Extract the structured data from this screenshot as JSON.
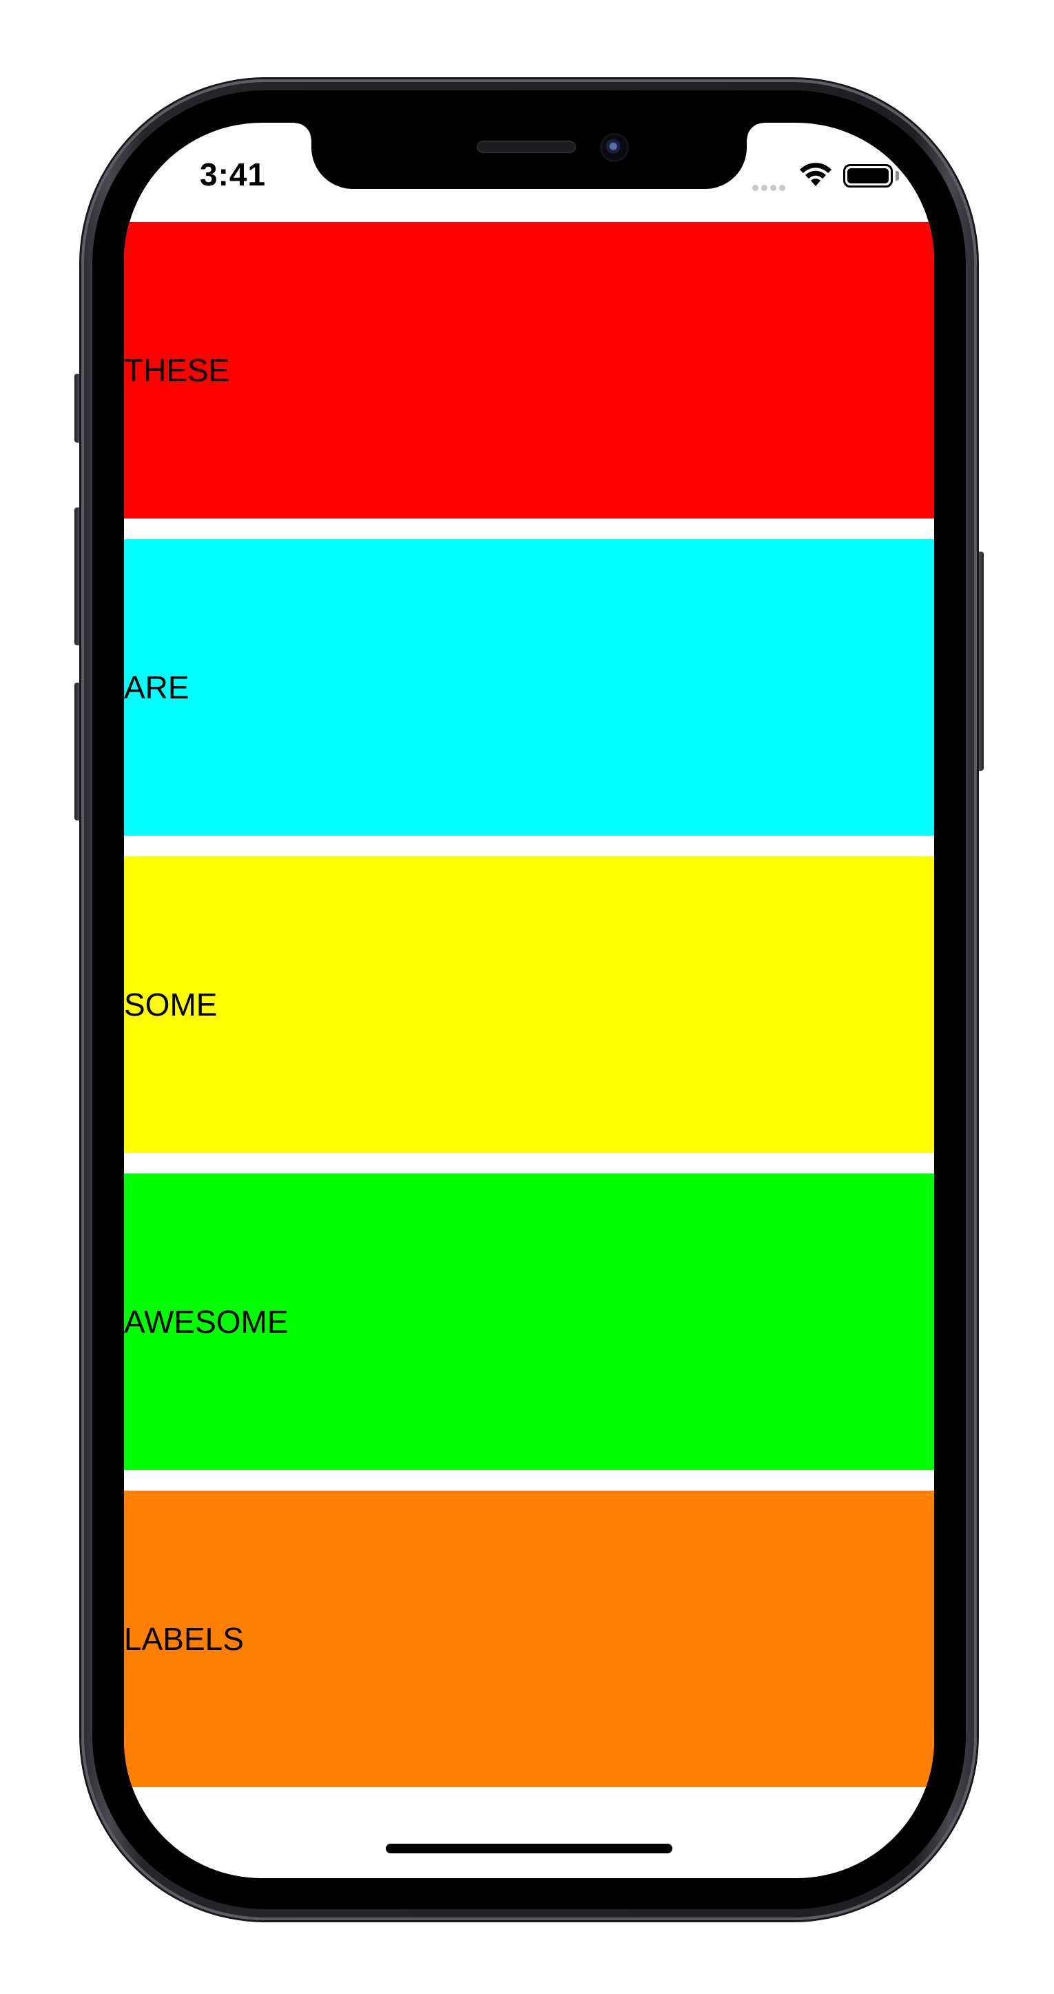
{
  "status_bar": {
    "time": "3:41",
    "icons": [
      "cellular-signal-icon",
      "wifi-icon",
      "battery-icon"
    ]
  },
  "labels": {
    "items": [
      {
        "text": "THESE",
        "background": "#ff0000"
      },
      {
        "text": "ARE",
        "background": "#00ffff"
      },
      {
        "text": "SOME",
        "background": "#ffff00"
      },
      {
        "text": "AWESOME",
        "background": "#00ff00"
      },
      {
        "text": "LABELS",
        "background": "#ff8000"
      }
    ]
  },
  "colors": {
    "screen_background": "#ffffff",
    "label_text": "#000000",
    "device_frame": "#2b2a30"
  }
}
